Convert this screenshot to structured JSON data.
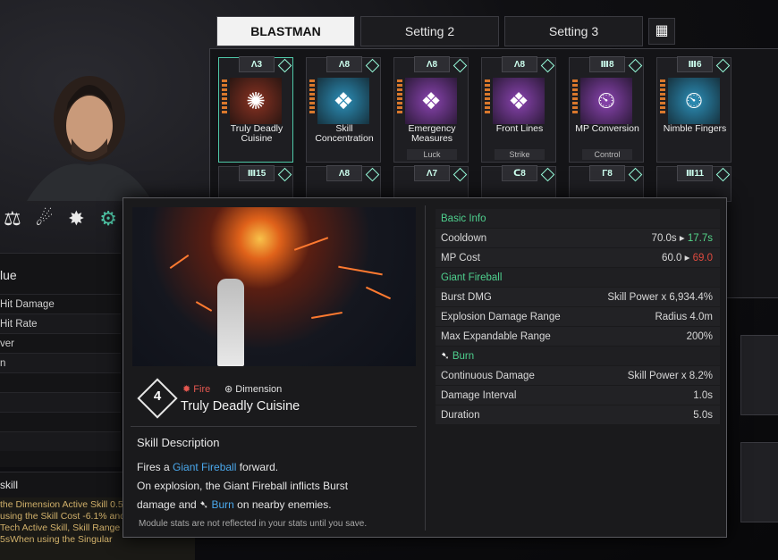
{
  "tabs": [
    "BLASTMAN",
    "Setting 2",
    "Setting 3"
  ],
  "modules_row1": [
    {
      "rank": "3",
      "name": "Truly Deadly Cuisine",
      "tag": "",
      "icon": "fireball-icon",
      "color": "#b24a2a"
    },
    {
      "rank": "8",
      "name": "Skill Concentration",
      "tag": "",
      "icon": "diamond-pattern-icon",
      "color": "#2c8fb8"
    },
    {
      "rank": "8",
      "name": "Emergency Measures",
      "tag": "Luck",
      "icon": "diamond-pattern-icon",
      "color": "#8a44b0"
    },
    {
      "rank": "8",
      "name": "Front Lines",
      "tag": "Strike",
      "icon": "diamond-pattern-icon",
      "color": "#8a44b0"
    },
    {
      "rank": "8",
      "name": "MP Conversion",
      "tag": "Control",
      "icon": "gauge-icon",
      "color": "#8a44b0"
    },
    {
      "rank": "6",
      "name": "Nimble Fingers",
      "tag": "",
      "icon": "gauge-icon",
      "color": "#2c8fb8"
    }
  ],
  "modules_row2_ranks": [
    "15",
    "8",
    "7",
    "8",
    "8",
    "11"
  ],
  "left": {
    "value_title": "lue",
    "rows": [
      "Hit Damage",
      "Hit Rate",
      "ver",
      "n"
    ],
    "skill_title": "skill",
    "skill_desc": "the Dimension Active Skill 0.5% for 5sWhen using the Skill Cost -6.1% and Durat g the Tech Active Skill, Skill Range and er +15% for 5sWhen using the Singular"
  },
  "tooltip": {
    "cost_num": "4",
    "attr_fire": "Fire",
    "attr_dimension": "Dimension",
    "title": "Truly Deadly Cuisine",
    "desc_head": "Skill Description",
    "desc_part1": "Fires a ",
    "desc_link1": "Giant Fireball",
    "desc_part2": " forward.",
    "desc_line2": "On explosion, the Giant Fireball inflicts Burst",
    "desc_part3": "damage and ",
    "desc_link2": "Burn",
    "desc_part4": " on nearby enemies.",
    "note": "Module stats are not reflected in your stats until you save.",
    "stats": {
      "basic_info": "Basic Info",
      "cooldown_label": "Cooldown",
      "cooldown_old": "70.0s",
      "cooldown_new": "17.7s",
      "mp_label": "MP Cost",
      "mp_old": "60.0",
      "mp_new": "69.0",
      "giant_fireball": "Giant Fireball",
      "burst_label": "Burst DMG",
      "burst_value": "Skill Power x 6,934.4%",
      "explosion_label": "Explosion Damage Range",
      "explosion_value": "Radius 4.0m",
      "max_range_label": "Max Expandable Range",
      "max_range_value": "200%",
      "burn": "Burn",
      "cont_label": "Continuous Damage",
      "cont_value": "Skill Power x 8.2%",
      "interval_label": "Damage Interval",
      "interval_value": "1.0s",
      "duration_label": "Duration",
      "duration_value": "5.0s"
    }
  }
}
